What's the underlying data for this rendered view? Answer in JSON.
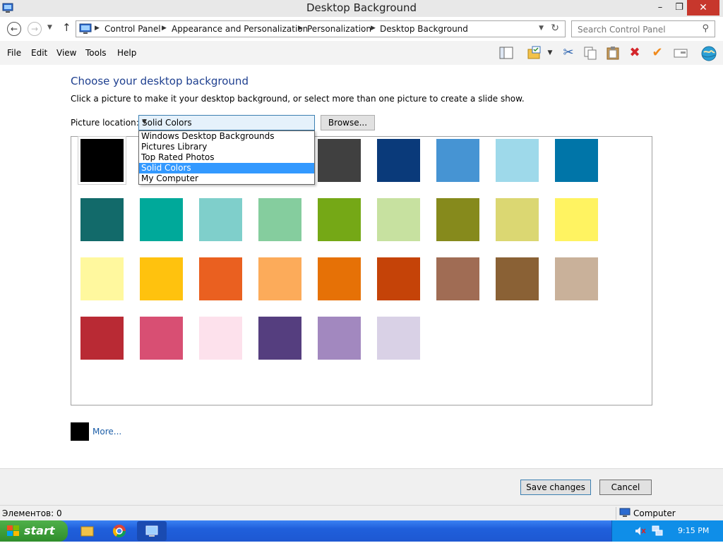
{
  "window": {
    "title": "Desktop Background",
    "minimize": "–",
    "maximize": "❐",
    "close": "✕"
  },
  "address": {
    "crumbs": [
      "Control Panel",
      "Appearance and Personalization",
      "Personalization",
      "Desktop Background"
    ],
    "search_placeholder": "Search Control Panel"
  },
  "menu": [
    "File",
    "Edit",
    "View",
    "Tools",
    "Help"
  ],
  "toolbar_icons": [
    "layout-icon",
    "folder-properties-icon",
    "cut-icon",
    "copy-icon",
    "paste-icon",
    "delete-icon",
    "checkmark-icon",
    "email-icon",
    "globe-icon"
  ],
  "content": {
    "heading": "Choose your desktop background",
    "subtext": "Click a picture to make it your desktop background, or select more than one picture to create a slide show.",
    "location_label": "Picture location:",
    "location_value": "Solid Colors",
    "browse_label": "Browse...",
    "dropdown_options": [
      "Windows Desktop Backgrounds",
      "Pictures Library",
      "Top Rated Photos",
      "Solid Colors",
      "My Computer"
    ],
    "dropdown_selected": "Solid Colors",
    "swatches": [
      [
        "#000000",
        "#6d6d6d",
        "#a5a5a5",
        "#cfcfcf",
        "#404040",
        "#0a3a7a",
        "#4694d3",
        "#9ed9ea",
        "#0075a8"
      ],
      [
        "#126a6a",
        "#00a99a",
        "#7fcfcb",
        "#85cd9e",
        "#75a816",
        "#c7e1a0",
        "#868a1c",
        "#dbd772",
        "#fff361"
      ],
      [
        "#fff89e",
        "#ffc20e",
        "#ea6020",
        "#fcab5a",
        "#e67106",
        "#c54308",
        "#a06c54",
        "#8a6135",
        "#c9b19a"
      ],
      [
        "#b92a34",
        "#d84f73",
        "#fde1ec",
        "#553e7f",
        "#a288bf",
        "#d9d1e6"
      ]
    ],
    "selected_color": "#000000",
    "more_label": "More..."
  },
  "footer": {
    "save_label": "Save changes",
    "cancel_label": "Cancel"
  },
  "status": {
    "items_text": "Элементов: 0",
    "location_text": "Computer"
  },
  "taskbar": {
    "start_label": "start",
    "clock": "9:15 PM"
  }
}
